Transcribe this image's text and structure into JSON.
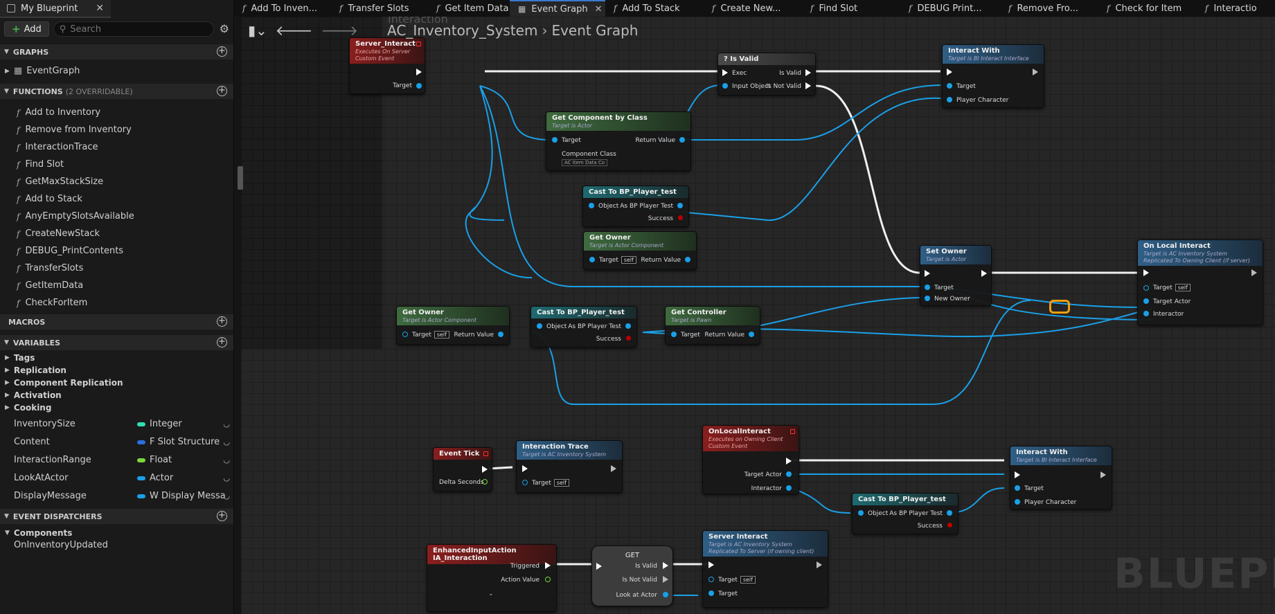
{
  "left_panel": {
    "tab_title": "My Blueprint",
    "add_label": "Add",
    "search_placeholder": "Search",
    "sections": {
      "graphs": "GRAPHS",
      "functions": "FUNCTIONS",
      "functions_sub": "(2 OVERRIDABLE)",
      "macros": "MACROS",
      "variables": "VARIABLES",
      "dispatchers": "EVENT DISPATCHERS"
    },
    "graphs": [
      "EventGraph"
    ],
    "functions": [
      "Add to Inventory",
      "Remove from Inventory",
      "InteractionTrace",
      "Find Slot",
      "GetMaxStackSize",
      "Add to Stack",
      "AnyEmptySlotsAvailable",
      "CreateNewStack",
      "DEBUG_PrintContents",
      "TransferSlots",
      "GetItemData",
      "CheckForItem"
    ],
    "var_categories": [
      "Tags",
      "Replication",
      "Component Replication",
      "Activation",
      "Cooking"
    ],
    "variables": [
      {
        "name": "InventorySize",
        "type": "Integer",
        "color": "#2ee0b0"
      },
      {
        "name": "Content",
        "type": "F Slot Structure",
        "color": "#2a6fe0"
      },
      {
        "name": "InteractionRange",
        "type": "Float",
        "color": "#7ad93a"
      },
      {
        "name": "LookAtActor",
        "type": "Actor",
        "color": "#1aa0e8"
      },
      {
        "name": "DisplayMessage",
        "type": "W Display Messa",
        "color": "#1aa0e8"
      }
    ],
    "dispatcher_category": "Components",
    "dispatchers": [
      "OnInventoryUpdated"
    ]
  },
  "tabs": [
    {
      "label": "Add To Inven...",
      "active": false
    },
    {
      "label": "Transfer Slots",
      "active": false
    },
    {
      "label": "Get Item Data",
      "active": false
    },
    {
      "label": "Event Graph",
      "active": true
    },
    {
      "label": "Add To Stack",
      "active": false
    },
    {
      "label": "Create New...",
      "active": false
    },
    {
      "label": "Find Slot",
      "active": false
    },
    {
      "label": "DEBUG Print...",
      "active": false
    },
    {
      "label": "Remove Fro...",
      "active": false
    },
    {
      "label": "Check for Item",
      "active": false
    },
    {
      "label": "Interactio",
      "active": false
    }
  ],
  "breadcrumb": {
    "root": "AC_Inventory_System",
    "current": "Event Graph"
  },
  "watermark": "BLUEPRINT",
  "comment_label": "Interaction",
  "nodes": {
    "server_interact_evt": {
      "title": "Server_Interact",
      "sub1": "Executes On Server",
      "sub2": "Custom Event",
      "target": "Target"
    },
    "is_valid": {
      "title": "? Is Valid",
      "exec": "Exec",
      "input": "Input Object",
      "valid": "Is Valid",
      "notvalid": "Is Not Valid"
    },
    "interact_with_1": {
      "title": "Interact With",
      "sub": "Target is BI Interact Interface",
      "target": "Target",
      "pc": "Player Character"
    },
    "get_component": {
      "title": "Get Component by Class",
      "sub": "Target is Actor",
      "target": "Target",
      "ret": "Return Value",
      "cc": "Component Class",
      "ccval": "AC Item Data Co"
    },
    "cast1": {
      "title": "Cast To BP_Player_test",
      "object": "Object",
      "as": "As BP Player Test",
      "success": "Success"
    },
    "get_owner1": {
      "title": "Get Owner",
      "sub": "Target is Actor Component",
      "target": "Target",
      "self": "self",
      "ret": "Return Value"
    },
    "set_owner": {
      "title": "Set Owner",
      "sub": "Target is Actor",
      "target": "Target",
      "new": "New Owner"
    },
    "on_local_interact": {
      "title": "On Local Interact",
      "sub1": "Target is AC Inventory System",
      "sub2": "Replicated To Owning Client (if server)",
      "target": "Target",
      "self": "self",
      "ta": "Target Actor",
      "inter": "Interactor"
    },
    "get_owner2": {
      "title": "Get Owner",
      "sub": "Target is Actor Component",
      "target": "Target",
      "self": "self",
      "ret": "Return Value"
    },
    "cast2": {
      "title": "Cast To BP_Player_test",
      "object": "Object",
      "as": "As BP Player Test",
      "success": "Success"
    },
    "get_controller": {
      "title": "Get Controller",
      "sub": "Target is Pawn",
      "target": "Target",
      "ret": "Return Value"
    },
    "event_tick": {
      "title": "Event Tick",
      "ds": "Delta Seconds"
    },
    "interaction_trace": {
      "title": "Interaction Trace",
      "sub": "Target is AC Inventory System",
      "target": "Target",
      "self": "self"
    },
    "onlocalinteract_evt": {
      "title": "OnLocalInteract",
      "sub1": "Executes on Owning Client",
      "sub2": "Custom Event",
      "ta": "Target Actor",
      "inter": "Interactor"
    },
    "interact_with_2": {
      "title": "Interact With",
      "sub": "Target is BI Interact Interface",
      "target": "Target",
      "pc": "Player Character"
    },
    "cast3": {
      "title": "Cast To BP_Player_test",
      "object": "Object",
      "as": "As BP Player Test",
      "success": "Success"
    },
    "enhanced_input": {
      "title": "EnhancedInputAction IA_Interaction",
      "trig": "Triggered",
      "av": "Action Value"
    },
    "get_node": {
      "title": "GET",
      "valid": "Is Valid",
      "notvalid": "Is Not Valid",
      "laa": "Look at Actor"
    },
    "server_interact_call": {
      "title": "Server Interact",
      "sub1": "Target is AC Inventory System",
      "sub2": "Replicated To Server (if owning client)",
      "target": "Target",
      "self": "self",
      "t2": "Target"
    }
  }
}
